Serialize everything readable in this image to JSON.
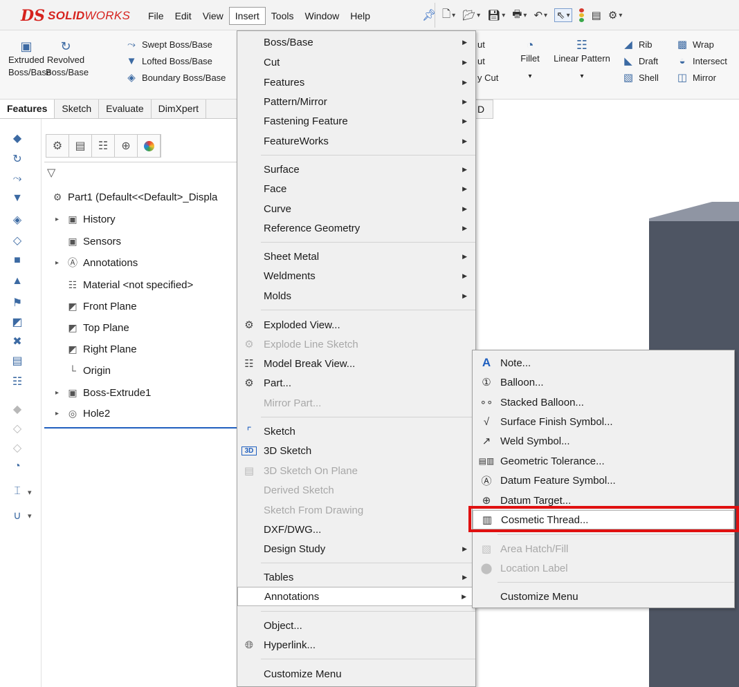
{
  "app": {
    "logo_prefix": "DS",
    "logo_bold": "SOLID",
    "logo_rest": "WORKS",
    "accent_color": "#d6231e",
    "highlight_color": "#e01010"
  },
  "menubar": {
    "items": [
      {
        "label": "File",
        "active": false
      },
      {
        "label": "Edit",
        "active": false
      },
      {
        "label": "View",
        "active": false
      },
      {
        "label": "Insert",
        "active": true
      },
      {
        "label": "Tools",
        "active": false
      },
      {
        "label": "Window",
        "active": false
      },
      {
        "label": "Help",
        "active": false
      }
    ]
  },
  "quick_access": [
    {
      "icon": "new-document-icon"
    },
    {
      "icon": "open-folder-icon"
    },
    {
      "icon": "save-icon"
    },
    {
      "icon": "print-icon"
    },
    {
      "icon": "undo-icon"
    },
    {
      "icon": "select-pointer-icon"
    },
    {
      "icon": "rebuild-traffic-light-icon"
    },
    {
      "icon": "file-properties-icon"
    },
    {
      "icon": "options-gear-icon"
    }
  ],
  "ribbon": {
    "extruded": "Extruded\nBoss/Base",
    "revolved": "Revolved\nBoss/Base",
    "swept": "Swept Boss/Base",
    "lofted": "Lofted Boss/Base",
    "boundary": "Boundary Boss/Base",
    "cut1": "ut",
    "cut2": "ut",
    "cut3": "y Cut",
    "fillet": "Fillet",
    "linear_pattern": "Linear Pattern",
    "rib": "Rib",
    "wrap": "Wrap",
    "draft": "Draft",
    "intersect": "Intersect",
    "shell": "Shell",
    "mirror": "Mirror"
  },
  "tabs": {
    "items": [
      {
        "label": "Features",
        "active": true
      },
      {
        "label": "Sketch",
        "active": false
      },
      {
        "label": "Evaluate",
        "active": false
      },
      {
        "label": "DimXpert",
        "active": false
      }
    ],
    "trailing": "D"
  },
  "tree": {
    "root": "Part1  (Default<<Default>_Displa",
    "nodes": [
      {
        "label": "History",
        "expandable": true,
        "icon": "history-folder-icon"
      },
      {
        "label": "Sensors",
        "expandable": false,
        "icon": "sensors-folder-icon"
      },
      {
        "label": "Annotations",
        "expandable": true,
        "icon": "annotations-folder-icon"
      },
      {
        "label": "Material <not specified>",
        "expandable": false,
        "icon": "material-icon"
      },
      {
        "label": "Front Plane",
        "expandable": false,
        "icon": "plane-icon"
      },
      {
        "label": "Top Plane",
        "expandable": false,
        "icon": "plane-icon"
      },
      {
        "label": "Right Plane",
        "expandable": false,
        "icon": "plane-icon"
      },
      {
        "label": "Origin",
        "expandable": false,
        "icon": "origin-icon"
      },
      {
        "label": "Boss-Extrude1",
        "expandable": true,
        "icon": "extrude-feature-icon"
      },
      {
        "label": "Hole2",
        "expandable": true,
        "icon": "hole-feature-icon"
      }
    ]
  },
  "insert_menu": {
    "items": [
      {
        "label": "Boss/Base",
        "submenu": true,
        "disabled": false,
        "icon": ""
      },
      {
        "label": "Cut",
        "submenu": true,
        "disabled": false,
        "icon": ""
      },
      {
        "label": "Features",
        "submenu": true,
        "disabled": false,
        "icon": ""
      },
      {
        "label": "Pattern/Mirror",
        "submenu": true,
        "disabled": false,
        "icon": ""
      },
      {
        "label": "Fastening Feature",
        "submenu": true,
        "disabled": false,
        "icon": ""
      },
      {
        "label": "FeatureWorks",
        "submenu": true,
        "disabled": false,
        "icon": ""
      },
      {
        "label": "Surface",
        "submenu": true,
        "disabled": false,
        "icon": ""
      },
      {
        "label": "Face",
        "submenu": true,
        "disabled": false,
        "icon": ""
      },
      {
        "label": "Curve",
        "submenu": true,
        "disabled": false,
        "icon": ""
      },
      {
        "label": "Reference Geometry",
        "submenu": true,
        "disabled": false,
        "icon": ""
      },
      {
        "label": "Sheet Metal",
        "submenu": true,
        "disabled": false,
        "icon": ""
      },
      {
        "label": "Weldments",
        "submenu": true,
        "disabled": false,
        "icon": ""
      },
      {
        "label": "Molds",
        "submenu": true,
        "disabled": false,
        "icon": ""
      },
      {
        "label": "Exploded View...",
        "submenu": false,
        "disabled": false,
        "icon": "exploded-view-icon"
      },
      {
        "label": "Explode Line Sketch",
        "submenu": false,
        "disabled": true,
        "icon": "explode-line-icon"
      },
      {
        "label": "Model Break View...",
        "submenu": false,
        "disabled": false,
        "icon": "model-break-icon"
      },
      {
        "label": "Part...",
        "submenu": false,
        "disabled": false,
        "icon": "insert-part-icon"
      },
      {
        "label": "Mirror Part...",
        "submenu": false,
        "disabled": true,
        "icon": ""
      },
      {
        "label": "Sketch",
        "submenu": false,
        "disabled": false,
        "icon": "sketch-icon"
      },
      {
        "label": "3D Sketch",
        "submenu": false,
        "disabled": false,
        "icon": "3d-sketch-icon"
      },
      {
        "label": "3D Sketch On Plane",
        "submenu": false,
        "disabled": true,
        "icon": "3d-sketch-on-plane-icon"
      },
      {
        "label": "Derived Sketch",
        "submenu": false,
        "disabled": true,
        "icon": ""
      },
      {
        "label": "Sketch From Drawing",
        "submenu": false,
        "disabled": true,
        "icon": ""
      },
      {
        "label": "DXF/DWG...",
        "submenu": false,
        "disabled": false,
        "icon": ""
      },
      {
        "label": "Design Study",
        "submenu": true,
        "disabled": false,
        "icon": ""
      },
      {
        "label": "Tables",
        "submenu": true,
        "disabled": false,
        "icon": ""
      },
      {
        "label": "Annotations",
        "submenu": true,
        "disabled": false,
        "icon": "",
        "highlighted": true
      },
      {
        "label": "Object...",
        "submenu": false,
        "disabled": false,
        "icon": ""
      },
      {
        "label": "Hyperlink...",
        "submenu": false,
        "disabled": false,
        "icon": "hyperlink-globe-icon"
      },
      {
        "label": "Customize Menu",
        "submenu": false,
        "disabled": false,
        "icon": ""
      }
    ]
  },
  "annotations_submenu": {
    "items": [
      {
        "label": "Note...",
        "disabled": false,
        "icon": "note-icon"
      },
      {
        "label": "Balloon...",
        "disabled": false,
        "icon": "balloon-icon"
      },
      {
        "label": "Stacked Balloon...",
        "disabled": false,
        "icon": "stacked-balloon-icon"
      },
      {
        "label": "Surface Finish Symbol...",
        "disabled": false,
        "icon": "surface-finish-icon"
      },
      {
        "label": "Weld Symbol...",
        "disabled": false,
        "icon": "weld-symbol-icon"
      },
      {
        "label": "Geometric Tolerance...",
        "disabled": false,
        "icon": "geometric-tolerance-icon"
      },
      {
        "label": "Datum Feature Symbol...",
        "disabled": false,
        "icon": "datum-feature-icon"
      },
      {
        "label": "Datum Target...",
        "disabled": false,
        "icon": "datum-target-icon"
      },
      {
        "label": "Cosmetic Thread...",
        "disabled": false,
        "icon": "cosmetic-thread-icon",
        "highlighted": true
      },
      {
        "label": "Area Hatch/Fill",
        "disabled": true,
        "icon": "area-hatch-icon"
      },
      {
        "label": "Location Label",
        "disabled": true,
        "icon": "location-label-icon"
      },
      {
        "label": "Customize Menu",
        "disabled": false,
        "icon": ""
      }
    ]
  }
}
